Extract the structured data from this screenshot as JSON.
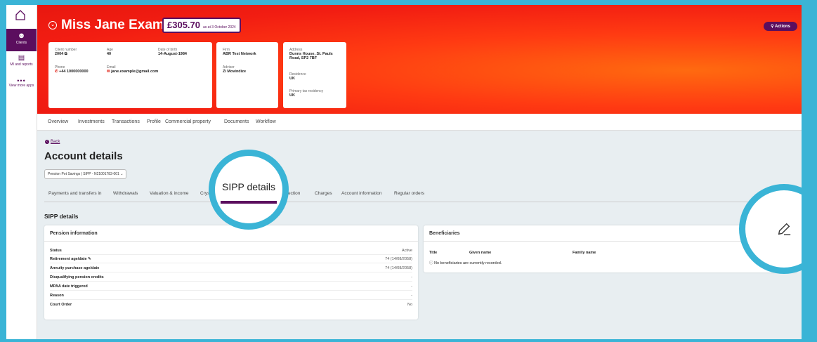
{
  "nav": {
    "clients_label": "Clients",
    "mi_label": "MI and reports",
    "more_label": "View more apps"
  },
  "client": {
    "name": "Miss Jane Example",
    "value": "£305.70",
    "value_asat": "as at 3 October 2024",
    "actions_label": "Actions",
    "client_number_label": "Client number",
    "client_number": "2004",
    "age_label": "Age",
    "age": "40",
    "dob_label": "Date of birth",
    "dob": "14-August-1984",
    "phone_label": "Phone",
    "phone": "+44 1000000000",
    "email_label": "Email",
    "email": "jane.example@gmail.com",
    "firm_label": "Firm",
    "firm": "ABR Test Network",
    "adviser_label": "Adviser",
    "adviser": "Zi Movindize",
    "address_label": "Address",
    "address": "Dunns House, St. Pauls Road, SP2 7BF",
    "residence_label": "Residence",
    "residence": "UK",
    "tax_label": "Primary tax residency",
    "tax": "UK"
  },
  "tabs": [
    "Overview",
    "Investments",
    "Transactions",
    "Profile",
    "Commercial property",
    "Documents",
    "Workflow"
  ],
  "back_label": "Back",
  "account_title": "Account details",
  "account_select": "Pension Pot Savings | SIPP - N21001783-001",
  "subtabs": {
    "payments": "Payments and transfers in",
    "withdrawals": "Withdrawals",
    "valuation": "Valuation & income",
    "crystal": "Crysta",
    "sipp": "SIPP details",
    "protection": "ection",
    "charges": "Charges",
    "account_info": "Account information",
    "regular": "Regular orders"
  },
  "sipp_heading": "SIPP details",
  "pension": {
    "title": "Pension information",
    "rows": [
      {
        "k": "Status",
        "v": "Active"
      },
      {
        "k": "Retirement age/date",
        "v": "74 (14/08/2058)"
      },
      {
        "k": "Annuity purchase age/date",
        "v": "74 (14/08/2058)"
      },
      {
        "k": "Disqualifying pension credits",
        "v": "-"
      },
      {
        "k": "MPAA date triggered",
        "v": "-"
      },
      {
        "k": "Reason",
        "v": "-"
      },
      {
        "k": "Court Order",
        "v": "No"
      }
    ]
  },
  "beneficiaries": {
    "title": "Beneficiaries",
    "col_title": "Title",
    "col_given": "Given name",
    "col_family": "Family name",
    "empty_msg": "No beneficiaries are currently recorded."
  },
  "colors": {
    "accent": "#5b0e5e",
    "hero": "#f21d12",
    "highlight": "#3ab4d6"
  }
}
